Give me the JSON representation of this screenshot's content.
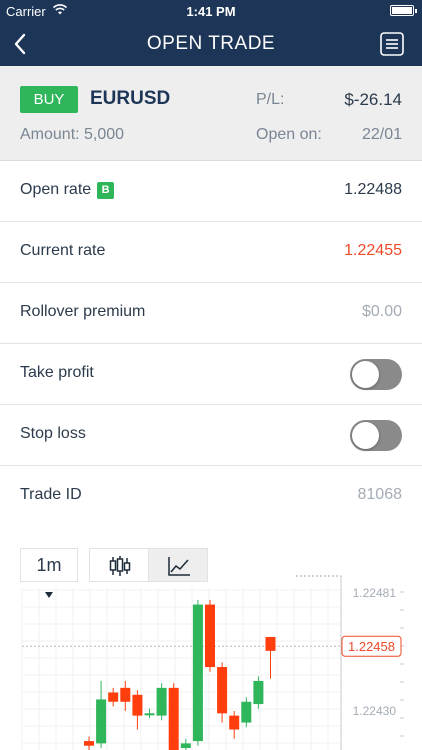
{
  "status_bar": {
    "carrier": "Carrier",
    "time": "1:41 PM"
  },
  "nav": {
    "title": "OPEN TRADE"
  },
  "summary": {
    "side": "BUY",
    "symbol": "EURUSD",
    "pl_label": "P/L:",
    "pl_value": "$-26.14",
    "amount": "Amount: 5,000",
    "open_on_label": "Open on:",
    "open_on_value": "22/01"
  },
  "rows": {
    "open_rate": {
      "label": "Open rate",
      "badge": "B",
      "value": "1.22488"
    },
    "current_rate": {
      "label": "Current rate",
      "value": "1.22455"
    },
    "rollover": {
      "label": "Rollover premium",
      "value": "$0.00"
    },
    "take_profit": {
      "label": "Take profit",
      "on": false
    },
    "stop_loss": {
      "label": "Stop loss",
      "on": false
    },
    "trade_id": {
      "label": "Trade ID",
      "value": "81068"
    }
  },
  "chart": {
    "timeframe": "1m",
    "active_type": "line",
    "colors": {
      "up": "#2fb55a",
      "down": "#ff3d0d",
      "price_label": "#ee4a2a"
    },
    "current_price_label": "1.22458",
    "chart_data": {
      "type": "candlestick",
      "y_tick_labels": [
        "1.22481",
        "1.22430"
      ],
      "y_ticks": [
        1.22481,
        1.2243
      ],
      "current_price": 1.22458,
      "candles": [
        {
          "open": 1.22417,
          "close": 1.22415,
          "high": 1.22419,
          "low": 1.22413
        },
        {
          "open": 1.22416,
          "close": 1.22435,
          "high": 1.22443,
          "low": 1.22414
        },
        {
          "open": 1.22438,
          "close": 1.22434,
          "high": 1.2244,
          "low": 1.22432
        },
        {
          "open": 1.2244,
          "close": 1.22434,
          "high": 1.22443,
          "low": 1.2243
        },
        {
          "open": 1.22437,
          "close": 1.22428,
          "high": 1.22439,
          "low": 1.22422
        },
        {
          "open": 1.22429,
          "close": 1.22429,
          "high": 1.22431,
          "low": 1.22427
        },
        {
          "open": 1.22428,
          "close": 1.2244,
          "high": 1.22442,
          "low": 1.22426
        },
        {
          "open": 1.2244,
          "close": 1.22413,
          "high": 1.22442,
          "low": 1.22411
        },
        {
          "open": 1.22414,
          "close": 1.22416,
          "high": 1.22418,
          "low": 1.22412
        },
        {
          "open": 1.22417,
          "close": 1.22476,
          "high": 1.22478,
          "low": 1.22415
        },
        {
          "open": 1.22476,
          "close": 1.22449,
          "high": 1.22478,
          "low": 1.22447
        },
        {
          "open": 1.22449,
          "close": 1.22429,
          "high": 1.22451,
          "low": 1.22425
        },
        {
          "open": 1.22428,
          "close": 1.22422,
          "high": 1.2243,
          "low": 1.22418
        },
        {
          "open": 1.22425,
          "close": 1.22434,
          "high": 1.22436,
          "low": 1.22423
        },
        {
          "open": 1.22433,
          "close": 1.22443,
          "high": 1.22445,
          "low": 1.22431
        },
        {
          "open": 1.22462,
          "close": 1.22456,
          "high": 1.22462,
          "low": 1.22444
        }
      ]
    }
  }
}
